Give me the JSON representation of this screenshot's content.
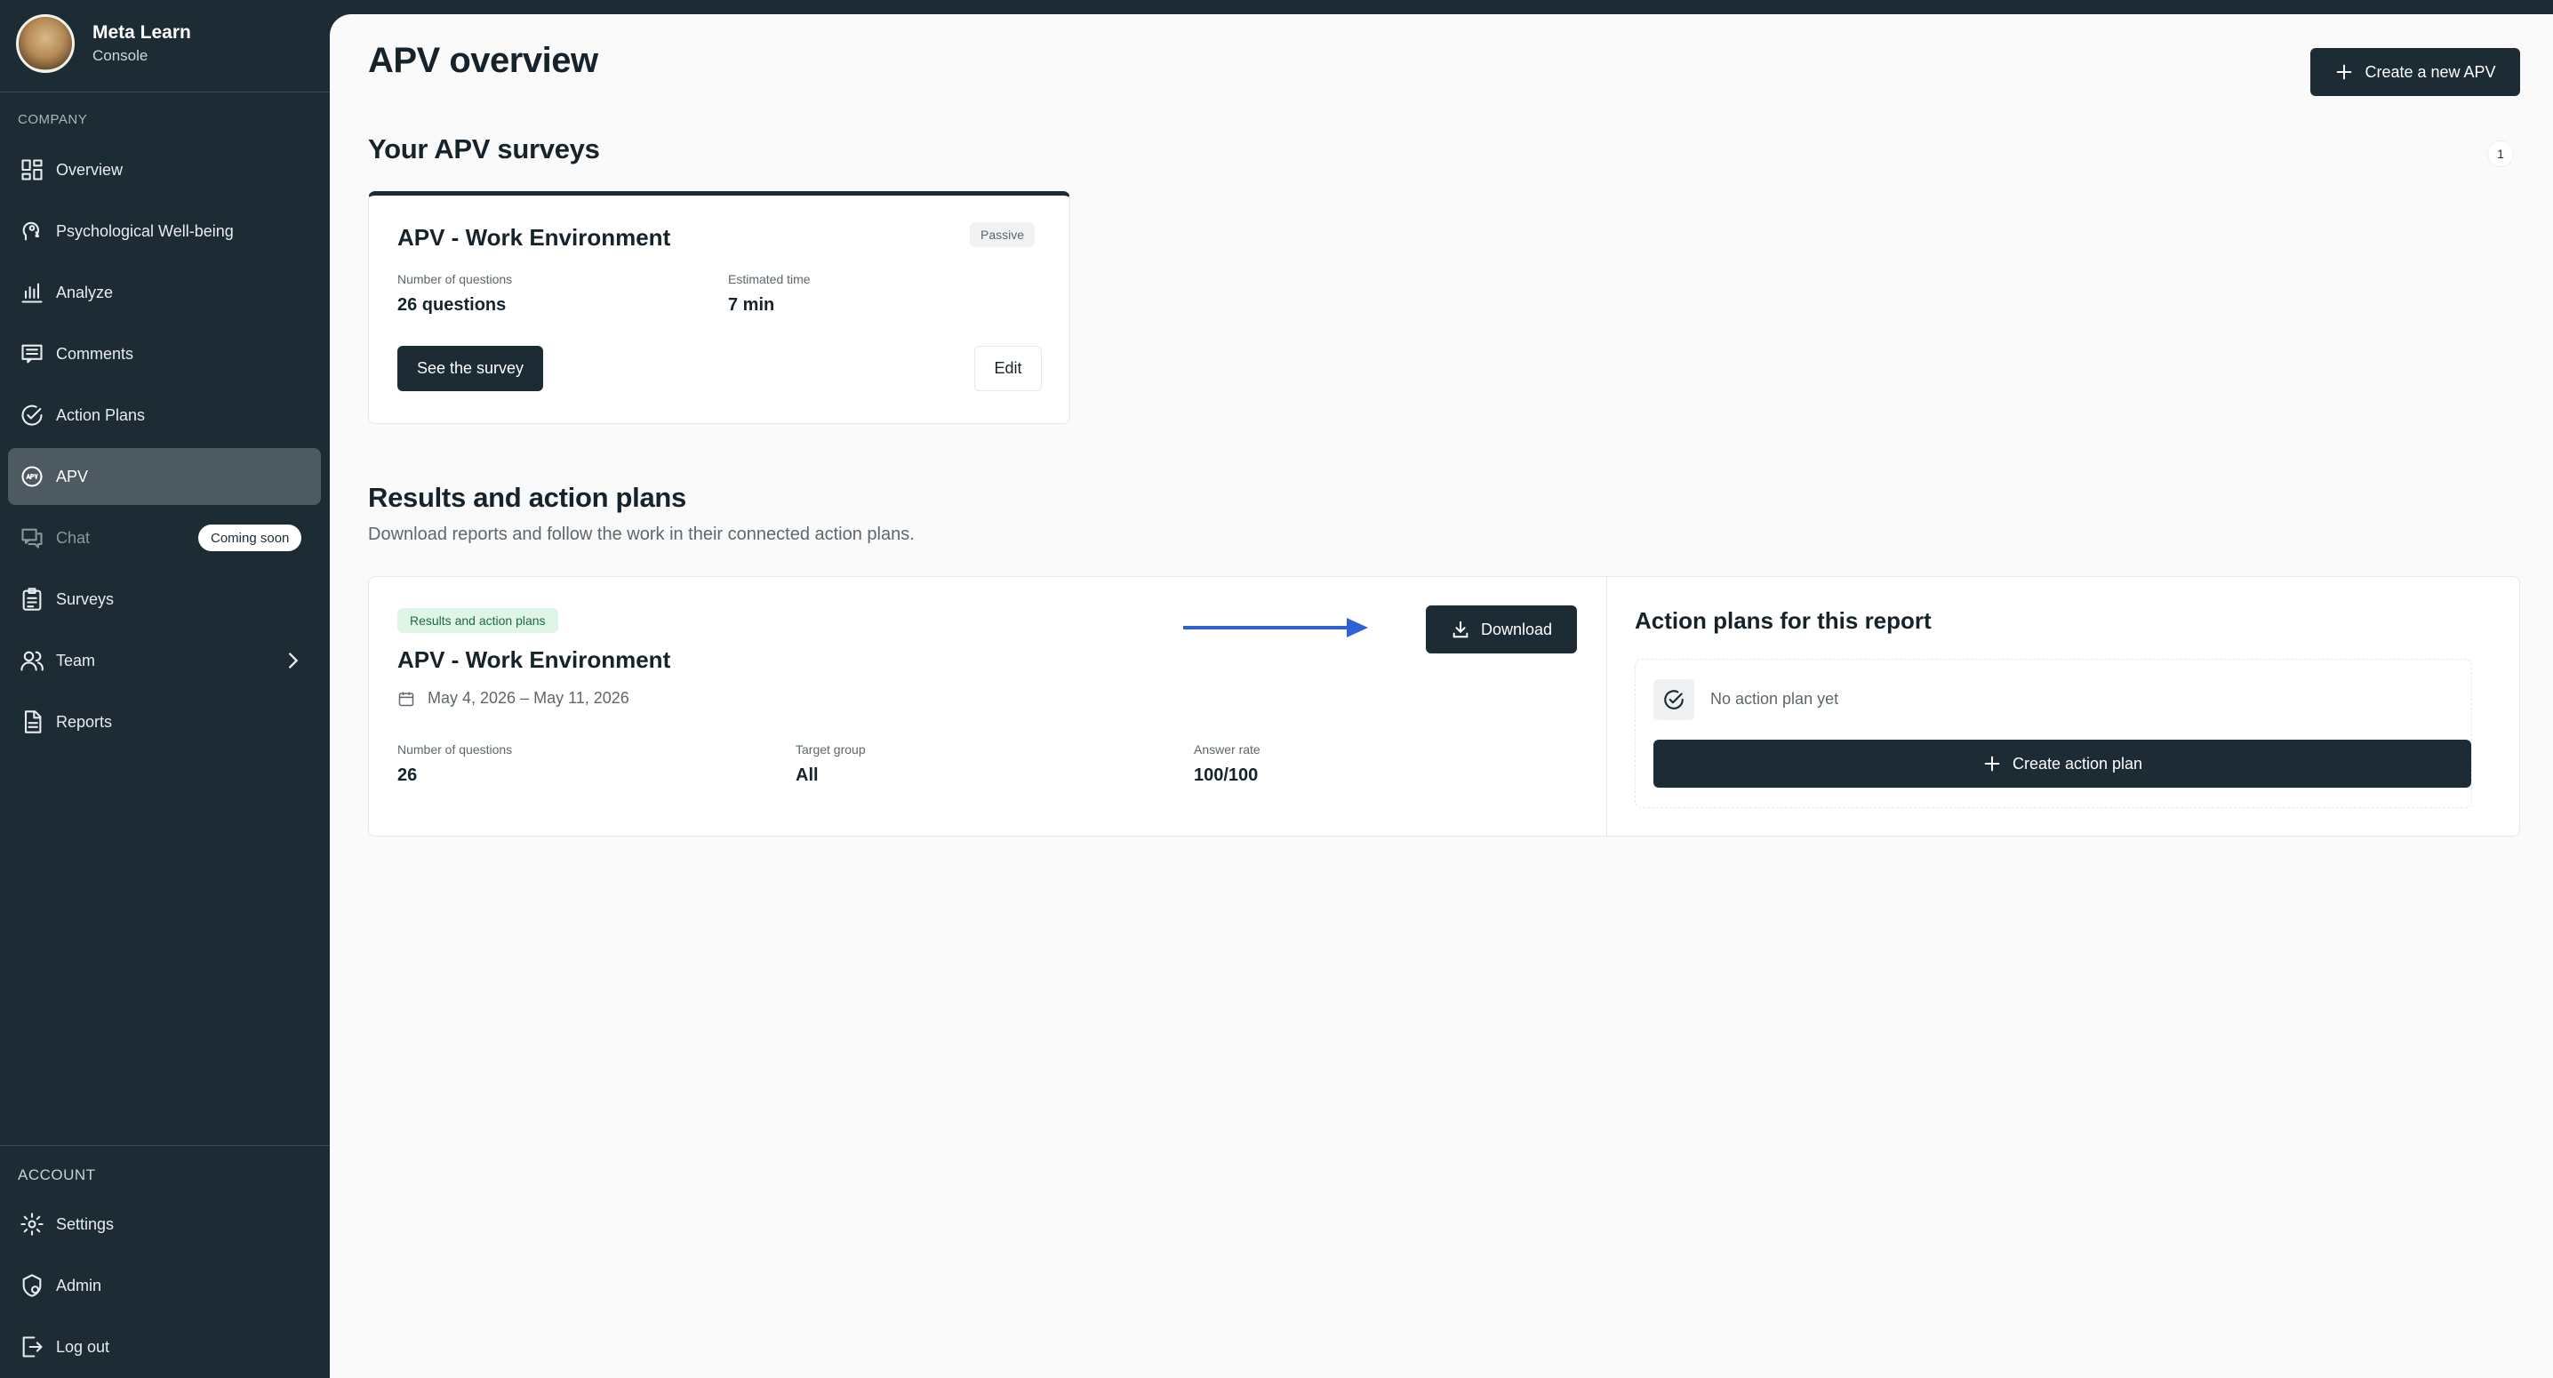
{
  "brand": {
    "name": "Meta Learn",
    "subtitle": "Console"
  },
  "sidebar": {
    "company_label": "COMPANY",
    "account_label": "ACCOUNT",
    "items": [
      {
        "label": "Overview",
        "icon": "grid-icon"
      },
      {
        "label": "Psychological Well-being",
        "icon": "head-icon"
      },
      {
        "label": "Analyze",
        "icon": "bar-chart-icon"
      },
      {
        "label": "Comments",
        "icon": "comment-icon"
      },
      {
        "label": "Action Plans",
        "icon": "check-circle-icon"
      },
      {
        "label": "APV",
        "icon": "apv-icon",
        "active": true
      },
      {
        "label": "Chat",
        "icon": "chat-icon",
        "badge": "Coming soon",
        "disabled": true
      },
      {
        "label": "Surveys",
        "icon": "clipboard-icon"
      },
      {
        "label": "Team",
        "icon": "users-icon",
        "expandable": true
      },
      {
        "label": "Reports",
        "icon": "report-icon"
      }
    ],
    "account_items": [
      {
        "label": "Settings",
        "icon": "gear-icon"
      },
      {
        "label": "Admin",
        "icon": "admin-icon"
      },
      {
        "label": "Log out",
        "icon": "logout-icon"
      }
    ]
  },
  "header": {
    "title": "APV overview",
    "create_label": "Create a new APV"
  },
  "surveys": {
    "title": "Your APV surveys",
    "count": "1",
    "card": {
      "title": "APV - Work Environment",
      "status": "Passive",
      "questions_label": "Number of questions",
      "questions_value": "26 questions",
      "time_label": "Estimated time",
      "time_value": "7 min",
      "see_label": "See the survey",
      "edit_label": "Edit"
    }
  },
  "results": {
    "title": "Results and action plans",
    "description": "Download reports and follow the work in their connected action plans.",
    "card": {
      "tag": "Results and action plans",
      "title": "APV - Work Environment",
      "date_range": "May 4, 2026 – May 11, 2026",
      "download_label": "Download",
      "questions_label": "Number of questions",
      "questions_value": "26",
      "target_label": "Target group",
      "target_value": "All",
      "rate_label": "Answer rate",
      "rate_value": "100/100"
    },
    "action_plans": {
      "title": "Action plans for this report",
      "empty_text": "No action plan yet",
      "create_label": "Create action plan"
    }
  },
  "colors": {
    "sidebar": "#1d2b34",
    "primary": "#1d2b34",
    "arrow": "#2f62d6",
    "tag_green_bg": "#dff5e8"
  }
}
